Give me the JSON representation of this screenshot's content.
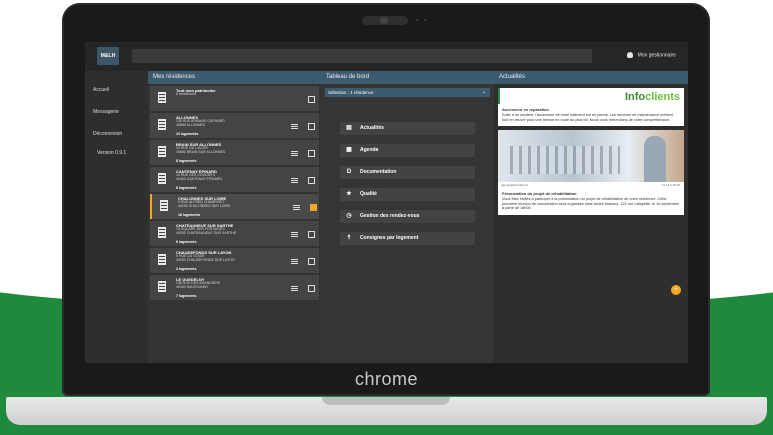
{
  "app": {
    "logo": "M&LH",
    "user": "Mon gestionnaire"
  },
  "nav": {
    "items": [
      "Accueil",
      "Messagerie",
      "Déconnexion"
    ],
    "version": "Version 0.9.1"
  },
  "columns": {
    "residences": "Mes résidences",
    "dashboard": "Tableau de bord",
    "news": "Actualités"
  },
  "residences": [
    {
      "name": "Tout mon patrimoine",
      "address": "8 résidences",
      "count": "",
      "checked": false,
      "selected": false
    },
    {
      "name": "ALLONNES",
      "address": "136 RUE ARMAND GUERARD\n49680 ALLONNES",
      "count": "10 logements",
      "checked": false,
      "selected": false
    },
    {
      "name": "BRAIN SUR ALLONNES",
      "address": "14 RUE DU LAVOIR\n49650 BRAIN SUR ALLONNES",
      "count": "8 logements",
      "checked": false,
      "selected": false
    },
    {
      "name": "CANTENAY EPINARD",
      "address": "10 RUE DES COUDRES\n49460 CANTENAY EPINARD",
      "count": "8 logements",
      "checked": false,
      "selected": false
    },
    {
      "name": "CHALONNES SUR LOIRE",
      "address": "9 RUE ALFRED CHAMPIRET\n49290 CHALONNES SUR LOIRE",
      "count": "16 logements",
      "checked": true,
      "selected": true
    },
    {
      "name": "CHATEAUNEUF SUR SARTHE",
      "address": "15 SQUARE DES FONTAINES\n49330 CHATEAUNEUF SUR SARTHE",
      "count": "6 logements",
      "checked": false,
      "selected": false
    },
    {
      "name": "CHAUDEFONDS SUR LAYON",
      "address": "6 RUE DU STADE\n49290 CHAUDEFONDS SUR LAYON",
      "count": "3 logements",
      "checked": false,
      "selected": false
    },
    {
      "name": "LE GUEDELNY",
      "address": "138 RUE DES AMANDIERS\n49400 SAUSSUNNY",
      "count": "7 logements",
      "checked": false,
      "selected": false
    }
  ],
  "dashboard": {
    "selection": "Sélection : 1 résidence",
    "menu": [
      {
        "label": "Actualités",
        "icon": "news-icon"
      },
      {
        "label": "Agenda",
        "icon": "calendar-icon"
      },
      {
        "label": "Documentation",
        "icon": "document-icon"
      },
      {
        "label": "Qualité",
        "icon": "quality-icon"
      },
      {
        "label": "Gestion des rendez-vous",
        "icon": "clock-icon"
      },
      {
        "label": "Consignes par logement",
        "icon": "person-icon"
      }
    ]
  },
  "news": {
    "brand_a": "Info",
    "brand_b": "clients",
    "item1": {
      "title": "Ascenseur en réparation",
      "text": "Suite à un incident, l'ascenseur de votre bâtiment est en panne. Les services de maintenance mettent tout en œuvre pour une remise en route au plus tôt. Nous vous remercions de votre compréhension."
    },
    "item2": {
      "meta": "agence@infoclient.fr",
      "date": "11.12.3 15:20",
      "title": "Présentation du projet de réhabilitation",
      "text": "Vous êtes invités à participer à la présentation du projet de réhabilitation de votre résidence. Cette première réunion de concertation sera organisée salle André Malraux, 121 rue Lafayette, le 16 septembre à partir de 18h00."
    }
  },
  "device": {
    "brand": "chrome"
  },
  "colors": {
    "accent": "#f5a623",
    "header": "#3d5b6f",
    "background_green": "#1f8a3b"
  }
}
